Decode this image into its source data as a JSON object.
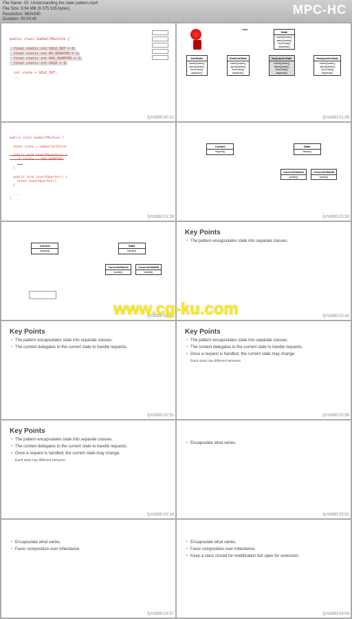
{
  "header": {
    "app": "MPC-HC"
  },
  "fileinfo": {
    "name": "File Name: 03. Understanding the state pattern.mp4",
    "size": "File Size: 8,94 MB (9 375 535 bytes)",
    "res": "Resolution: 960x540",
    "dur": "Duration: 00:04:40"
  },
  "watermark": "www.cg-ku.com",
  "lynda": "lynda",
  "slides": {
    "s1": {
      "code": "public class GumballMachine {\n\n  final static int SOLD_OUT = 0;\n  final static int NO_QUARTER = 1;\n  final static int HAS_QUARTER = 2;\n  final static int SOLD = 3;\n\n  int state = SOLD_OUT;\n  ...",
      "tc": "00:00:22"
    },
    "s2": {
      "label_state": "state",
      "state": {
        "t": "State",
        "b": "insertQuarter()\nejectQuarter()\nturnCrank()\ndispense()"
      },
      "sold": {
        "t": "SoldState",
        "b": "insertQuarter()\nejectQuarter()\nturnCrank()\ndispense()"
      },
      "soldout": {
        "t": "SoldOutState",
        "b": "insertQuarter()\nejectQuarter()\nturnCrank()\ndispense()"
      },
      "noq": {
        "t": "NoQuarterState",
        "b": "insertQuarter()\nejectQuarter()\nturnCrank()\ndispense()"
      },
      "hasq": {
        "t": "HasQuarterState",
        "b": "insertQuarter()\nejectQuarter()\nturnCrank()\ndispense()"
      },
      "tc": "00:01:05"
    },
    "s3": {
      "code": "public class GumballMachine {\n\n  State state = noQuarterState;\n\n  public void insertQuarter() {\n    if (state == HAS_QUARTER)\n    ...\n  }\n\n  public void insertQuarter() {\n    state.insertQuarter();\n  }\n\n  ...\n}",
      "tc": "00:01:38"
    },
    "s4": {
      "context": {
        "t": "Context",
        "b": "request()"
      },
      "state": {
        "t": "State",
        "b": "handle()"
      },
      "csa": {
        "t": "ConcreteStateA",
        "b": "handle()"
      },
      "csb": {
        "t": "ConcreteStateB",
        "b": "handle()"
      },
      "tc": "00:01:50"
    },
    "s5": {
      "tc": "00:02:16"
    },
    "s6": {
      "title": "Key Points",
      "p1": "The pattern encapsulates state into separate classes.",
      "tc": "00:02:43"
    },
    "s7": {
      "title": "Key Points",
      "p1": "The pattern encapsulates state into separate classes.",
      "p2": "The context delegates to the current state to handle requests.",
      "tc": "00:02:51"
    },
    "s8": {
      "title": "Key Points",
      "p1": "The pattern encapsulates state into separate classes.",
      "p2": "The context delegates to the current state to handle requests.",
      "p3": "Once a request is handled, the current state may change.",
      "sub": "Each state has different behavior.",
      "tc": "00:02:56"
    },
    "s9": {
      "title": "Key Points",
      "p1": "The pattern encapsulates state into separate classes.",
      "p2": "The context delegates to the current state to handle requests.",
      "p3": "Once a request is handled, the current state may change.",
      "sub": "Each state has different behavior.",
      "tc": "00:03:14"
    },
    "s10": {
      "p1": "Encapsulate what varies.",
      "tc": "00:03:51"
    },
    "s11": {
      "p1": "Encapsulate what varies.",
      "p2": "Favor composition over inheritance.",
      "tc": "00:03:57"
    },
    "s12": {
      "p1": "Encapsulate what varies.",
      "p2": "Favor composition over inheritance.",
      "p3": "Keep a class closed for modification but open for extension.",
      "tc": "00:04:04"
    }
  }
}
